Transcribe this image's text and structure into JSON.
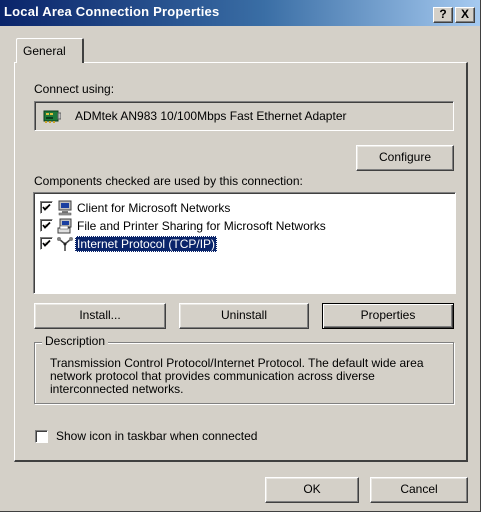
{
  "window": {
    "title": "Local Area Connection Properties",
    "help_label": "?",
    "close_label": "X"
  },
  "tabs": [
    {
      "label": "General",
      "selected": true
    }
  ],
  "connect_using": {
    "label": "Connect using:",
    "adapter": "ADMtek AN983 10/100Mbps Fast Ethernet Adapter",
    "adapter_icon": "network-adapter-icon",
    "configure_label": "Configure"
  },
  "components": {
    "label": "Components checked are used by this connection:",
    "items": [
      {
        "label": "Client for Microsoft Networks",
        "checked": true,
        "icon": "network-client-icon",
        "selected": false
      },
      {
        "label": "File and Printer Sharing for Microsoft Networks",
        "checked": true,
        "icon": "file-printer-sharing-icon",
        "selected": false
      },
      {
        "label": "Internet Protocol (TCP/IP)",
        "checked": true,
        "icon": "protocol-icon",
        "selected": true
      }
    ]
  },
  "actions": {
    "install_label": "Install...",
    "uninstall_label": "Uninstall",
    "properties_label": "Properties"
  },
  "description": {
    "legend": "Description",
    "text": "Transmission Control Protocol/Internet Protocol. The default wide area network protocol that provides communication across diverse interconnected networks."
  },
  "show_icon": {
    "label": "Show icon in taskbar when connected",
    "checked": false
  },
  "footer": {
    "ok_label": "OK",
    "cancel_label": "Cancel"
  },
  "colors": {
    "title_gradient_start": "#0a246a",
    "title_gradient_end": "#a6caf0",
    "dialog_face": "#d4d0c8",
    "selection": "#0a246a"
  }
}
